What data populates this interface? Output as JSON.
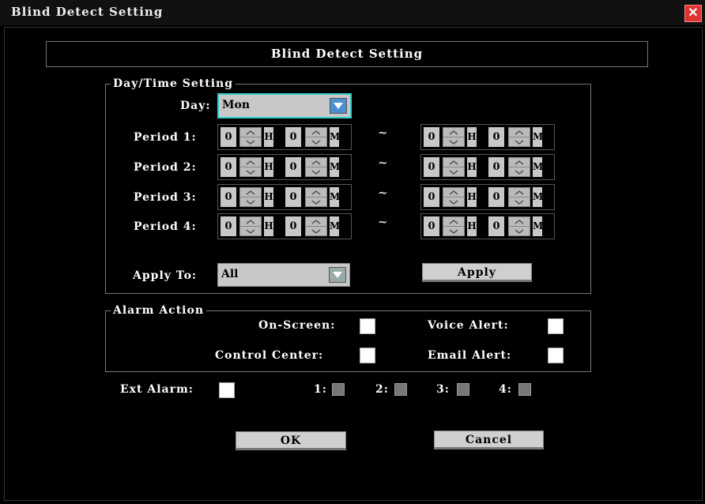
{
  "window": {
    "title": "Blind Detect Setting",
    "close_glyph": "✕"
  },
  "header": {
    "title": "Blind Detect Setting"
  },
  "daytime": {
    "legend": "Day/Time Setting",
    "day_label": "Day:",
    "day_value": "Mon",
    "tilde": "~",
    "periods": [
      {
        "label": "Period 1:",
        "start": {
          "h": "0",
          "h_unit": "H",
          "m": "0",
          "m_unit": "M"
        },
        "end": {
          "h": "0",
          "h_unit": "H",
          "m": "0",
          "m_unit": "M"
        }
      },
      {
        "label": "Period 2:",
        "start": {
          "h": "0",
          "h_unit": "H",
          "m": "0",
          "m_unit": "M"
        },
        "end": {
          "h": "0",
          "h_unit": "H",
          "m": "0",
          "m_unit": "M"
        }
      },
      {
        "label": "Period 3:",
        "start": {
          "h": "0",
          "h_unit": "H",
          "m": "0",
          "m_unit": "M"
        },
        "end": {
          "h": "0",
          "h_unit": "H",
          "m": "0",
          "m_unit": "M"
        }
      },
      {
        "label": "Period 4:",
        "start": {
          "h": "0",
          "h_unit": "H",
          "m": "0",
          "m_unit": "M"
        },
        "end": {
          "h": "0",
          "h_unit": "H",
          "m": "0",
          "m_unit": "M"
        }
      }
    ],
    "apply_to_label": "Apply To:",
    "apply_to_value": "All",
    "apply_button": "Apply"
  },
  "alarm": {
    "legend": "Alarm Action",
    "on_screen": "On-Screen:",
    "voice_alert": "Voice Alert:",
    "control_center": "Control Center:",
    "email_alert": "Email Alert:"
  },
  "ext": {
    "label": "Ext Alarm:",
    "channels": [
      "1:",
      "2:",
      "3:",
      "4:"
    ]
  },
  "buttons": {
    "ok": "OK",
    "cancel": "Cancel"
  },
  "icons": {
    "spin_up": "chevron-up-icon",
    "spin_down": "chevron-down-icon",
    "dropdown": "triangle-down-icon",
    "close": "close-icon"
  },
  "colors": {
    "background": "#000000",
    "field": "#c8c8c8",
    "day_focus": "#33cccc",
    "close": "#dd3333"
  }
}
